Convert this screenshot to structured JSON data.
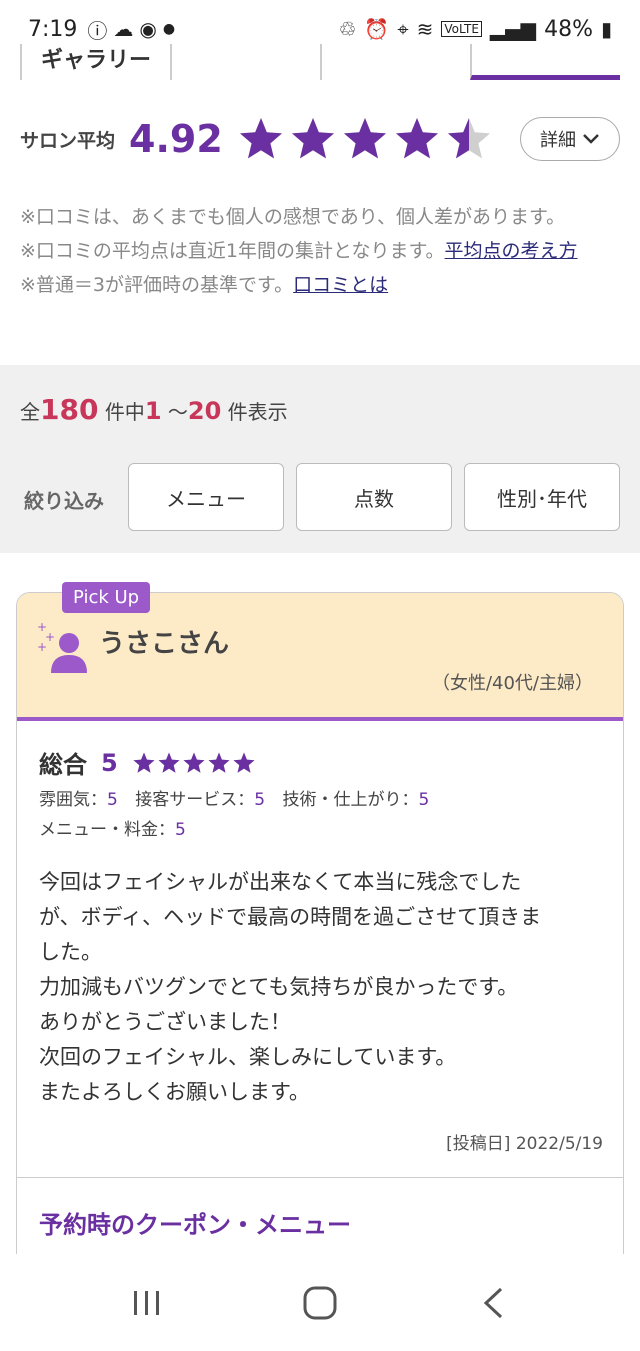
{
  "status_bar": {
    "time": "7:19",
    "battery": "48%",
    "icons": [
      "info-icon",
      "cloud-icon",
      "app-icon",
      "dot-icon",
      "recycle-icon",
      "alarm-icon",
      "location-icon",
      "wifi-icon",
      "volte-icon",
      "signal-icon",
      "battery-icon"
    ]
  },
  "tabs": [
    {
      "label": "ギャラリー",
      "active": false
    },
    {
      "label": "",
      "active": false
    },
    {
      "label": "",
      "active": false
    },
    {
      "label": "",
      "active": true
    }
  ],
  "rating": {
    "label": "サロン平均",
    "value": "4.92",
    "stars": 4.92,
    "detail_label": "詳細",
    "star_color": "#6a2fa0"
  },
  "notes": {
    "line1": "※口コミは、あくまでも個人の感想であり、個人差があります。",
    "line2_text": "※口コミの平均点は直近1年間の集計となります。",
    "line2_link": "平均点の考え方",
    "line3_text": "※普通＝3が評価時の基準です。",
    "line3_link": "口コミとは"
  },
  "count": {
    "prefix": "全",
    "total": "180",
    "mid": "件中",
    "from": "1",
    "tilde": "～",
    "to": "20",
    "suffix": "件表示"
  },
  "filter": {
    "label": "絞り込み",
    "buttons": [
      "メニュー",
      "点数",
      "性別･年代"
    ]
  },
  "review": {
    "pickup": "Pick Up",
    "name": "うさこさん",
    "info": "（女性/40代/主婦）",
    "overall_label": "総合",
    "overall_value": "5",
    "scores": [
      {
        "label": "雰囲気：",
        "value": "5"
      },
      {
        "label": "接客サービス：",
        "value": "5"
      },
      {
        "label": "技術・仕上がり：",
        "value": "5"
      },
      {
        "label": "メニュー・料金：",
        "value": "5"
      }
    ],
    "body": "今回はフェイシャルが出来なくて本当に残念でした\nが、ボディ、ヘッドで最高の時間を過ごさせて頂きま\nした。\n力加減もバツグンでとても気持ちが良かったです。\nありがとうございました！\n次回のフェイシャル、楽しみにしています。\nまたよろしくお願いします。",
    "post_date": "[投稿日] 2022/5/19",
    "coupon_title": "予約時のクーポン・メニュー"
  },
  "nav": {
    "icons": [
      "recent-apps-icon",
      "home-icon",
      "back-icon"
    ]
  }
}
